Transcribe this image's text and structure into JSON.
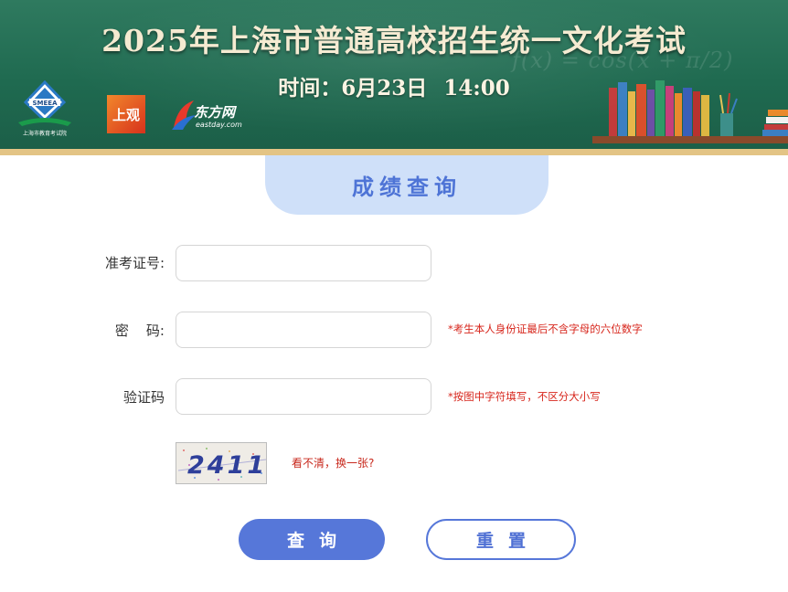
{
  "banner": {
    "title": "2025年上海市普通高校招生统一文化考试",
    "time_label": "时间：6月23日",
    "time_value": "14:00",
    "chalk_formula": "f(x) = cos(x + π/2)",
    "logos": {
      "smeea_text": "SMEEA",
      "smeea_caption": "上海市教育考试院",
      "shangguan": "上观",
      "eastday_name": "东方网",
      "eastday_domain": "eastday.com"
    }
  },
  "tab": {
    "title": "成绩查询"
  },
  "form": {
    "exam_id": {
      "label": "准考证号:",
      "value": "",
      "placeholder": ""
    },
    "password": {
      "label": "密    码:",
      "value": "",
      "placeholder": "",
      "hint": "*考生本人身份证最后不含字母的六位数字"
    },
    "captcha": {
      "label": "验证码",
      "value": "",
      "placeholder": "",
      "hint": "*按图中字符填写，不区分大小写",
      "image_text": "2411",
      "refresh_label": "看不清，换一张?"
    }
  },
  "buttons": {
    "query_label": "查询",
    "reset_label": "重置"
  },
  "colors": {
    "banner_green": "#1f6a50",
    "accent_blue": "#5677d9",
    "hint_red": "#d7261c",
    "tab_bg": "#cfe0f9"
  }
}
